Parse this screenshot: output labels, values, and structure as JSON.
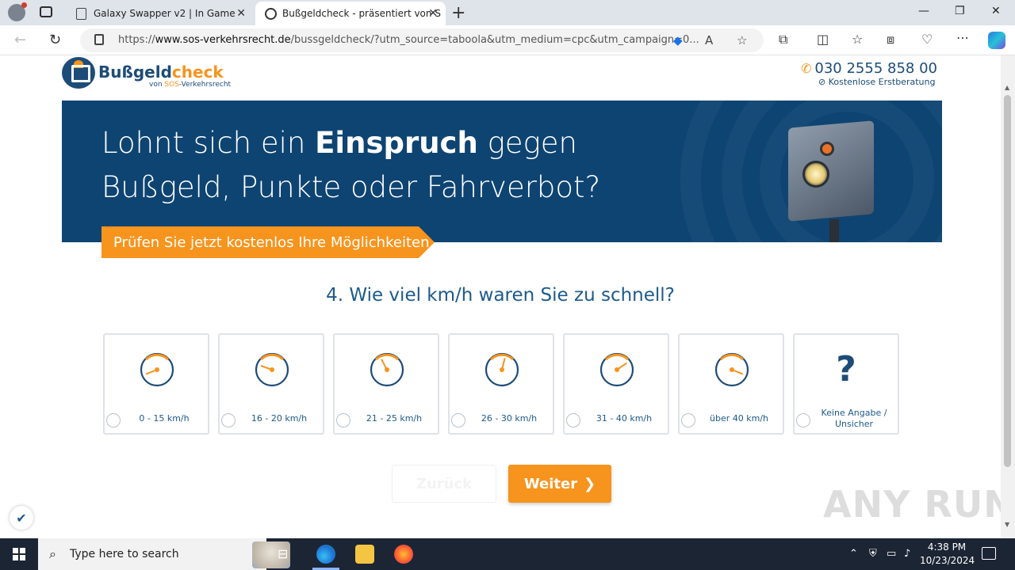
{
  "browser": {
    "tabs": [
      {
        "title": "Galaxy Swapper v2 | In Game"
      },
      {
        "title": "Bußgeldcheck - präsentiert von S"
      }
    ],
    "url_prefix": "https://",
    "url_domain": "www.sos-verkehrsrecht.de",
    "url_rest": "/bussgeldcheck/?utm_source=taboola&utm_medium=cpc&utm_campaign=0..."
  },
  "header": {
    "logo_main": "Bußgeld",
    "logo_accent": "check",
    "logo_sub_prefix": "von ",
    "logo_sub_accent": "SOS",
    "logo_sub_suffix": "-Verkehrsrecht",
    "phone": "030 2555 858 00",
    "consult": "Kostenlose Erstberatung"
  },
  "hero": {
    "line1_a": "Lohnt sich ein ",
    "line1_bold": "Einspruch",
    "line1_b": " gegen",
    "line2": "Bußgeld, Punkte oder Fahrverbot?",
    "ribbon": "Prüfen Sie jetzt kostenlos Ihre Möglichkeiten"
  },
  "question": "4. Wie viel km/h waren Sie zu schnell?",
  "options": [
    {
      "label": "0 - 15 km/h",
      "level": 0.1
    },
    {
      "label": "16 - 20 km/h",
      "level": 0.25
    },
    {
      "label": "21 - 25 km/h",
      "level": 0.4
    },
    {
      "label": "26 - 30 km/h",
      "level": 0.55
    },
    {
      "label": "31 - 40 km/h",
      "level": 0.7
    },
    {
      "label": "über 40 km/h",
      "level": 0.9
    },
    {
      "label": "Keine Angabe / Unsicher",
      "level": null
    }
  ],
  "buttons": {
    "back": "Zurück",
    "next": "Weiter"
  },
  "watermark": "ANY RUN",
  "taskbar": {
    "search_placeholder": "Type here to search",
    "time": "4:38 PM",
    "date": "10/23/2024"
  },
  "colors": {
    "brand_blue": "#0e4472",
    "accent_orange": "#f7941d",
    "question_blue": "#1d5a8a"
  }
}
